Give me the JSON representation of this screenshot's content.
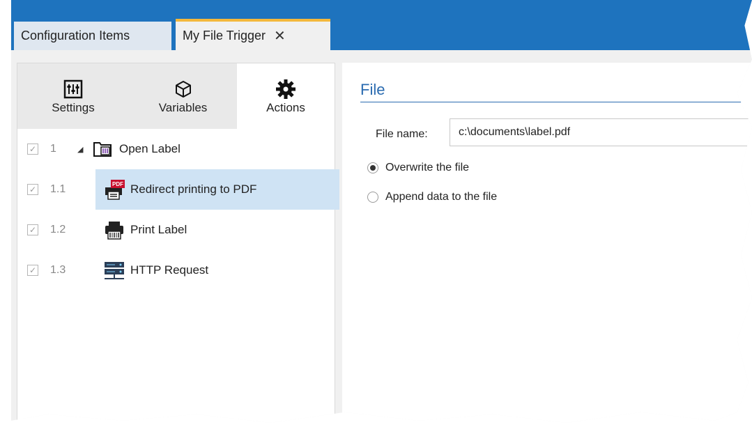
{
  "tabs": {
    "configuration_items": "Configuration Items",
    "my_file_trigger": "My File Trigger",
    "close_glyph": "✕"
  },
  "left_tabs": {
    "settings": "Settings",
    "variables": "Variables",
    "actions": "Actions"
  },
  "actions": [
    {
      "number": "1",
      "label": "Open Label",
      "checked": true,
      "icon": "folder-label-icon"
    },
    {
      "number": "1.1",
      "label": "Redirect printing to PDF",
      "checked": true,
      "icon": "pdf-printer-icon",
      "selected": true
    },
    {
      "number": "1.2",
      "label": "Print Label",
      "checked": true,
      "icon": "printer-icon"
    },
    {
      "number": "1.3",
      "label": "HTTP Request",
      "checked": true,
      "icon": "server-network-icon"
    }
  ],
  "file_section": {
    "title": "File",
    "file_name_label": "File name:",
    "file_name_value": "c:\\documents\\label.pdf",
    "option_overwrite": "Overwrite the file",
    "option_append": "Append data to the file",
    "selected_option": "overwrite"
  },
  "colors": {
    "topbar": "#1e73be",
    "active_tab_accent": "#f4b83c",
    "section_title": "#2a6bb0",
    "selected_row": "#cfe3f4"
  }
}
